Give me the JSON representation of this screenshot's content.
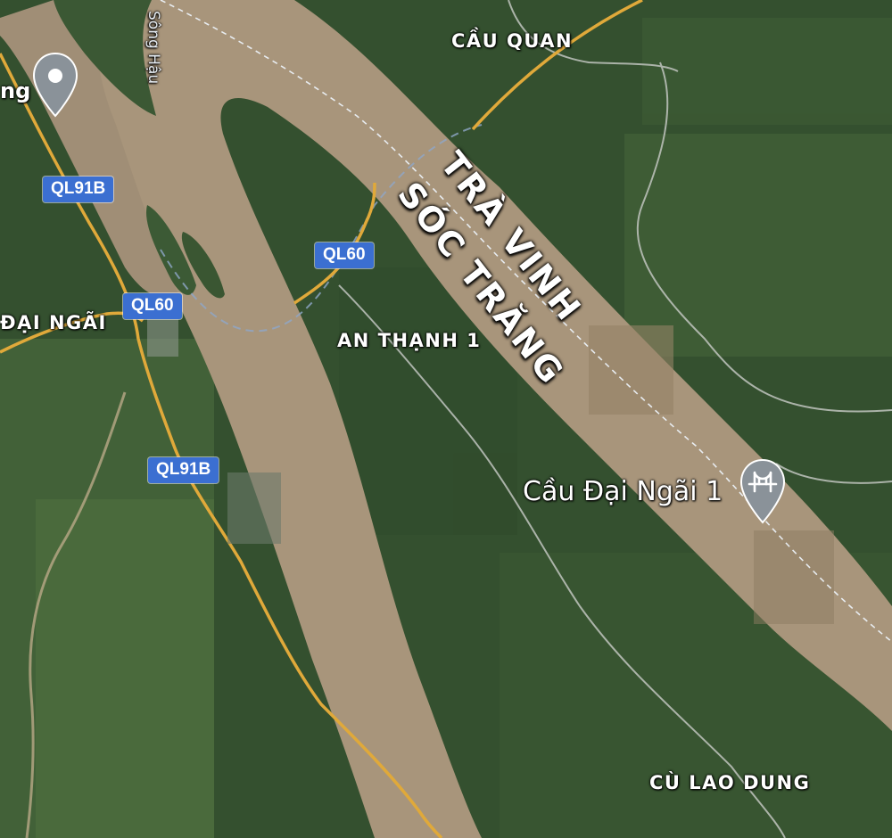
{
  "map": {
    "colors": {
      "land": "#3a5532",
      "land_light": "#4b6a3c",
      "field": "#587a45",
      "river": "#a8957b",
      "road_major": "#e0a93a",
      "boundary": "#d8dde3",
      "shield": "#3b6fd1"
    },
    "labels": {
      "place_cau_quan": "CẦU QUAN",
      "river_song_hau": "Sông Hậu",
      "province_tra_vinh": "TRÀ VINH",
      "province_soc_trang": "SÓC TRĂNG",
      "place_dai_ngai": "ĐẠI NGÃI",
      "place_an_thanh_1": "AN THẠNH 1",
      "poi_cau_dai_ngai_1": "Cầu Đại Ngãi 1",
      "place_cu_lao_dung": "CÙ LAO DUNG",
      "place_partial_left": "ng"
    },
    "shields": {
      "ql91b_top": "QL91B",
      "ql60_right": "QL60",
      "ql60_left": "QL60",
      "ql91b_bottom": "QL91B"
    },
    "icons": {
      "bridge_pin": "bridge-pin-icon",
      "location_pin": "location-pin-icon"
    }
  }
}
